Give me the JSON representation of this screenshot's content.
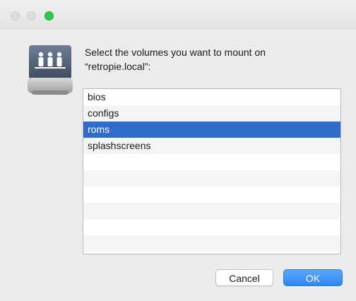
{
  "dialog": {
    "prompt_line1": "Select the volumes you want to mount on",
    "prompt_line2": "“retropie.local”:",
    "volumes": [
      {
        "label": "bios",
        "selected": false
      },
      {
        "label": "configs",
        "selected": false
      },
      {
        "label": "roms",
        "selected": true
      },
      {
        "label": "splashscreens",
        "selected": false
      }
    ],
    "cancel_label": "Cancel",
    "ok_label": "OK"
  },
  "window": {
    "traffic_lights": [
      "close",
      "minimize",
      "zoom"
    ]
  },
  "icon": {
    "name": "network-server-drive-icon"
  },
  "colors": {
    "selection": "#2f6ccb",
    "ok_button": "#2e86f5",
    "zoom_light": "#2ec94a"
  }
}
